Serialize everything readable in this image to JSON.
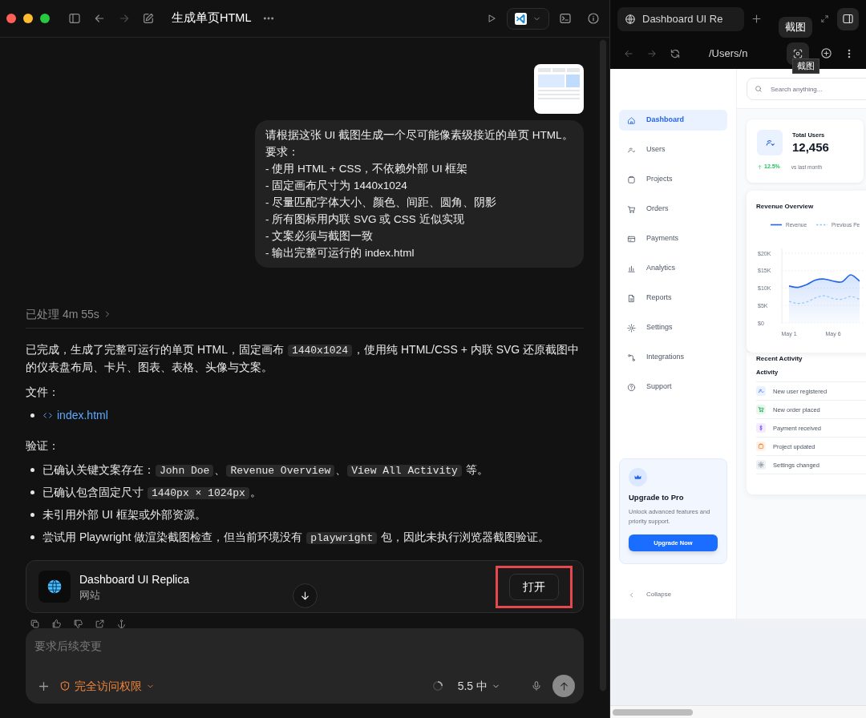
{
  "window": {
    "title": "生成单页HTML"
  },
  "chat": {
    "user_message": [
      "请根据这张 UI 截图生成一个尽可能像素级接近的单页 HTML。",
      "要求：",
      "- 使用 HTML + CSS，不依赖外部 UI 框架",
      "- 固定画布尺寸为 1440x1024",
      "- 尽量匹配字体大小、颜色、间距、圆角、阴影",
      "- 所有图标用内联 SVG 或 CSS 近似实现",
      "- 文案必须与截图一致",
      "- 输出完整可运行的 index.html"
    ],
    "processed": "已处理 4m 55s",
    "response": [
      {
        "kind": "paragraph",
        "segments": [
          {
            "text": "已完成，生成了完整可运行的单页 HTML，固定画布 ",
            "code": false
          },
          {
            "text": "1440x1024",
            "code": true
          },
          {
            "text": "，使用纯 HTML/CSS + 内联 SVG 还原截图中的仪表盘布局、卡片、图表、表格、头像与文案。",
            "code": false
          }
        ]
      },
      {
        "kind": "heading",
        "segments": [
          {
            "text": "文件：",
            "code": false
          }
        ]
      },
      {
        "kind": "file",
        "segments": [
          {
            "text": "index.html",
            "code": false
          }
        ]
      },
      {
        "kind": "heading",
        "segments": [
          {
            "text": "验证：",
            "code": false
          }
        ]
      },
      {
        "kind": "bullet",
        "segments": [
          {
            "text": "已确认关键文案存在：",
            "code": false
          },
          {
            "text": "John Doe",
            "code": true
          },
          {
            "text": "、",
            "code": false
          },
          {
            "text": "Revenue Overview",
            "code": true
          },
          {
            "text": "、",
            "code": false
          },
          {
            "text": "View All Activity",
            "code": true
          },
          {
            "text": " 等。",
            "code": false
          }
        ]
      },
      {
        "kind": "bullet",
        "segments": [
          {
            "text": "已确认包含固定尺寸 ",
            "code": false
          },
          {
            "text": "1440px × 1024px",
            "code": true
          },
          {
            "text": "。",
            "code": false
          }
        ]
      },
      {
        "kind": "bullet",
        "segments": [
          {
            "text": "未引用外部 UI 框架或外部资源。",
            "code": false
          }
        ]
      },
      {
        "kind": "bullet",
        "segments": [
          {
            "text": "尝试用 Playwright 做渲染截图检查，但当前环境没有 ",
            "code": false
          },
          {
            "text": "playwright",
            "code": true
          },
          {
            "text": " 包，因此未执行浏览器截图验证。",
            "code": false
          }
        ]
      }
    ],
    "artifact": {
      "title": "Dashboard UI Replica",
      "subtitle": "网站",
      "button": "打开",
      "highlighted": true
    },
    "composer": {
      "placeholder": "要求后续变更",
      "access": "完全访问权限",
      "model": "5.5 中"
    }
  },
  "browser": {
    "tab_title": "Dashboard UI Re",
    "address": "/Users/n",
    "tooltips": [
      "截图",
      "截图"
    ],
    "page": {
      "search_placeholder": "Search anything...",
      "nav": [
        {
          "label": "Dashboard",
          "selected": true
        },
        {
          "label": "Users",
          "selected": false
        },
        {
          "label": "Projects",
          "selected": false
        },
        {
          "label": "Orders",
          "selected": false
        },
        {
          "label": "Payments",
          "selected": false
        },
        {
          "label": "Analytics",
          "selected": false
        },
        {
          "label": "Reports",
          "selected": false
        },
        {
          "label": "Settings",
          "selected": false
        },
        {
          "label": "Integrations",
          "selected": false
        },
        {
          "label": "Support",
          "selected": false
        }
      ],
      "stat": {
        "title": "Total Users",
        "value": "12,456",
        "change": "12.5%",
        "compare": "vs last month"
      },
      "revenue": {
        "title": "Revenue Overview",
        "chart_data": {
          "type": "area",
          "grid": true,
          "categories": [
            "May 1",
            null,
            null,
            null,
            null,
            "May 6",
            null,
            null,
            null
          ],
          "ylim": [
            0,
            20000
          ],
          "yticks": [
            {
              "value": 0,
              "label": "$0"
            },
            {
              "value": 5000,
              "label": "$5K"
            },
            {
              "value": 10000,
              "label": "$10K"
            },
            {
              "value": 15000,
              "label": "$15K"
            },
            {
              "value": 20000,
              "label": "$20K"
            }
          ],
          "series": [
            {
              "name": "Revenue",
              "line_style": "solid",
              "color": "#2563eb",
              "values": [
                10600,
                10200,
                11000,
                12300,
                12600,
                12000,
                11800,
                13800,
                12000
              ]
            },
            {
              "name": "Previous Pe",
              "type": "line",
              "line_style": "dashed",
              "color": "#93c5fd",
              "values": [
                6200,
                5600,
                6000,
                7200,
                7800,
                7000,
                6800,
                7600,
                6800
              ]
            }
          ]
        }
      },
      "activity": {
        "title": "Recent Activity",
        "column": "Activity",
        "rows": [
          {
            "kind": "user",
            "label": "New user registered"
          },
          {
            "kind": "order",
            "label": "New order placed"
          },
          {
            "kind": "payment",
            "label": "Payment received"
          },
          {
            "kind": "project",
            "label": "Project updated"
          },
          {
            "kind": "settings",
            "label": "Settings changed"
          }
        ]
      },
      "upgrade": {
        "title": "Upgrade to Pro",
        "text": "Unlock advanced features and priority support.",
        "button": "Upgrade Now"
      },
      "collapse": "Collapse"
    }
  }
}
